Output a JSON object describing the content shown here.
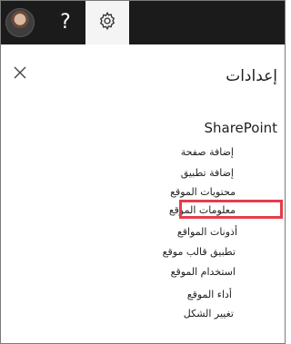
{
  "topbar": {
    "avatar_icon": "user-avatar",
    "help_icon": "question-mark-icon",
    "help_glyph": "?",
    "settings_icon": "gear-icon",
    "background": "#1b1b1b",
    "active_button_bg": "#f4f4f4"
  },
  "panel": {
    "close_icon": "close-icon",
    "title": "إعدادات",
    "section_title": "SharePoint",
    "items": [
      {
        "label": "إضافة صفحة"
      },
      {
        "label": "إضافة تطبيق"
      },
      {
        "label": "محتويات الموقع"
      },
      {
        "label": "معلومات الموقع",
        "highlighted": true
      },
      {
        "label": "أذونات المواقع"
      },
      {
        "label": "تطبيق قالب موقع"
      },
      {
        "label": "استخدام الموقع"
      },
      {
        "label": "أداء الموقع"
      },
      {
        "label": "تغيير الشكل"
      }
    ],
    "highlight_color": "#e63c4b"
  }
}
